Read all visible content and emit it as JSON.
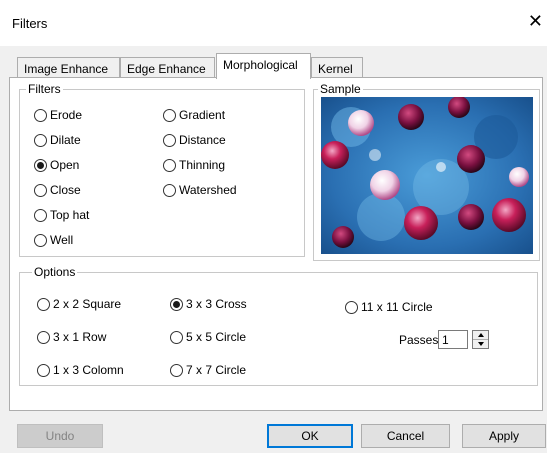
{
  "window": {
    "title": "Filters",
    "close_glyph": "✕"
  },
  "tabs": [
    {
      "label": "Image Enhance",
      "active": false
    },
    {
      "label": "Edge Enhance",
      "active": false
    },
    {
      "label": "Morphological",
      "active": true
    },
    {
      "label": "Kernel",
      "active": false
    }
  ],
  "filters": {
    "legend": "Filters",
    "selected": "Open",
    "items": [
      "Erode",
      "Dilate",
      "Open",
      "Close",
      "Top hat",
      "Well",
      "Gradient",
      "Distance",
      "Thinning",
      "Watershed"
    ]
  },
  "sample": {
    "legend": "Sample"
  },
  "options": {
    "legend": "Options",
    "selected": "3 x 3 Cross",
    "items": [
      "2 x 2 Square",
      "3 x 1 Row",
      "1 x 3 Colomn",
      "3 x 3 Cross",
      "5 x 5 Circle",
      "7 x 7 Circle",
      "11 x 11 Circle"
    ],
    "passes_label": "Passes",
    "passes_value": "1"
  },
  "buttons": {
    "undo": "Undo",
    "ok": "OK",
    "cancel": "Cancel",
    "apply": "Apply"
  },
  "icons": {
    "close": "close-icon",
    "spin_up": "spin-up-icon",
    "spin_down": "spin-down-icon"
  }
}
